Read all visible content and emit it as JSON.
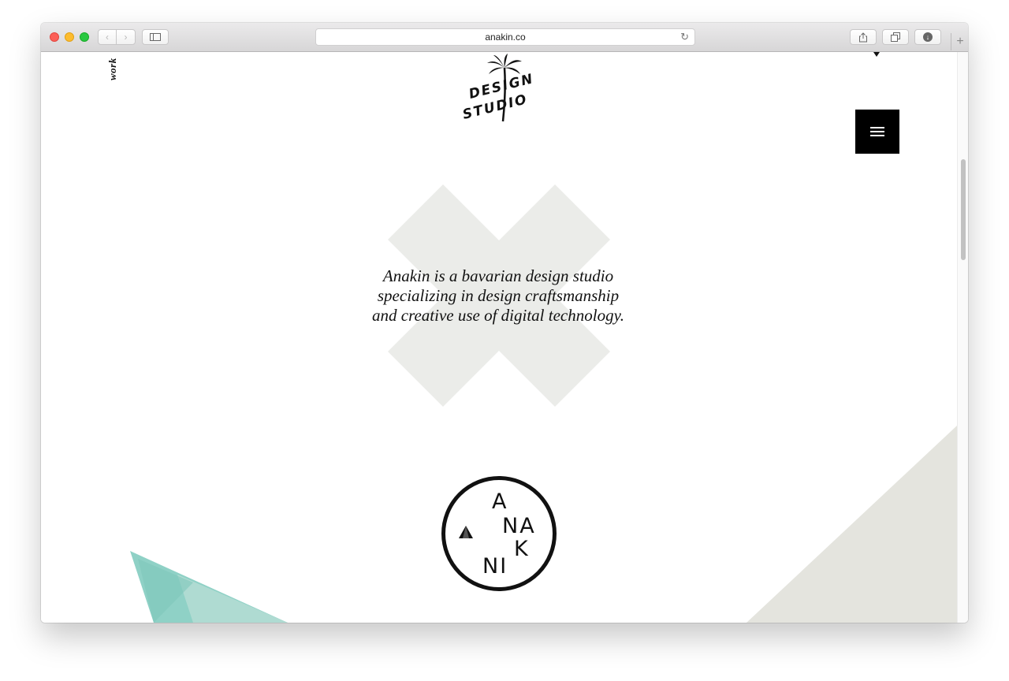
{
  "browser": {
    "url": "anakin.co",
    "icons": {
      "back": "chevron-left-icon",
      "forward": "chevron-right-icon",
      "sidebar": "sidebar-icon",
      "reload": "reload-icon",
      "share": "share-icon",
      "tabs": "tabs-icon",
      "download": "download-icon",
      "new_tab": "plus-icon"
    }
  },
  "page": {
    "nav_work": "work",
    "logo": {
      "line1": "DESIGN",
      "line2": "STUDIO",
      "icon": "palm-tree-icon"
    },
    "menu_icon": "hamburger-menu-icon",
    "tagline": [
      "Anakin is a bavarian design studio",
      "specializing in design craftsmanship",
      "and creative use of digital technology."
    ],
    "badge": {
      "letters": [
        "A",
        "NA",
        "K",
        "NI"
      ],
      "icon": "triangle-icon"
    }
  },
  "colors": {
    "accent_x": "#ebece9",
    "triangle_teal": "#8fd1c6",
    "triangle_grey": "#e4e4de",
    "menu_bg": "#000000"
  }
}
